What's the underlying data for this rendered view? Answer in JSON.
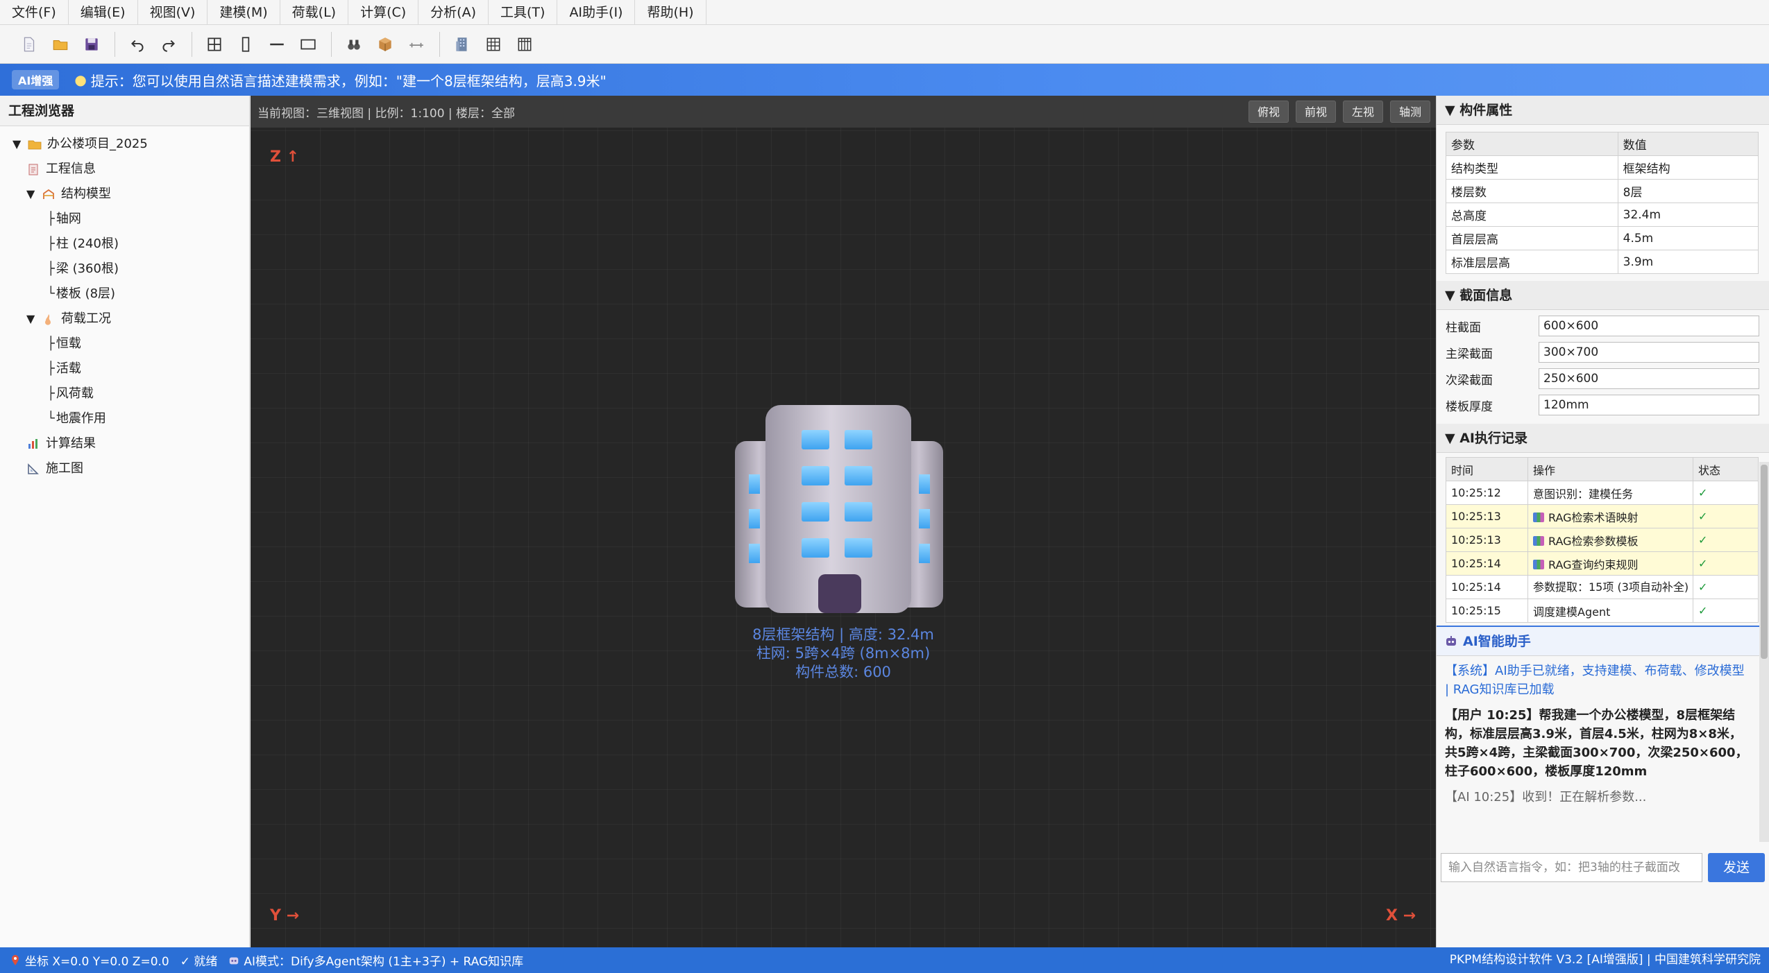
{
  "menu": [
    "文件(F)",
    "编辑(E)",
    "视图(V)",
    "建模(M)",
    "荷载(L)",
    "计算(C)",
    "分析(A)",
    "工具(T)",
    "AI助手(I)",
    "帮助(H)"
  ],
  "toolbar_icons": [
    "new-file-icon",
    "open-folder-icon",
    "save-icon",
    "undo-icon",
    "redo-icon",
    "grid-axis-icon",
    "column-icon",
    "beam-icon",
    "slab-icon",
    "find-icon",
    "3d-box-icon",
    "measure-icon",
    "building-icon",
    "table-icon",
    "columns-table-icon"
  ],
  "ai_banner": {
    "tag": "AI增强",
    "hint": "提示：您可以使用自然语言描述建模需求，例如：\"建一个8层框架结构，层高3.9米\""
  },
  "explorer": {
    "title": "工程浏览器",
    "project": "办公楼项目_2025",
    "project_info": "工程信息",
    "struct_model": "结构模型",
    "axis_grid": "轴网",
    "columns": "柱 (240根)",
    "beams": "梁 (360根)",
    "slabs": "楼板 (8层)",
    "loads": "荷载工况",
    "dead": "恒载",
    "live": "活载",
    "wind": "风荷载",
    "seismic": "地震作用",
    "results": "计算结果",
    "drawings": "施工图"
  },
  "viewport": {
    "info": "当前视图：三维视图 | 比例：1:100 | 楼层：全部",
    "buttons": [
      "俯视",
      "前视",
      "左视",
      "轴测"
    ],
    "axis_z": "Z ↑",
    "axis_y": "Y →",
    "axis_x": "X →",
    "building_line1": "8层框架结构 | 高度: 32.4m",
    "building_line2": "柱网: 5跨×4跨 (8m×8m)",
    "building_line3": "构件总数: 600"
  },
  "props": {
    "title": "▼ 构件属性",
    "col_param": "参数",
    "col_value": "数值",
    "rows": [
      {
        "k": "结构类型",
        "v": "框架结构"
      },
      {
        "k": "楼层数",
        "v": "8层"
      },
      {
        "k": "总高度",
        "v": "32.4m"
      },
      {
        "k": "首层层高",
        "v": "4.5m"
      },
      {
        "k": "标准层层高",
        "v": "3.9m"
      }
    ]
  },
  "section": {
    "title": "▼ 截面信息",
    "rows": [
      {
        "k": "柱截面",
        "v": "600×600"
      },
      {
        "k": "主梁截面",
        "v": "300×700"
      },
      {
        "k": "次梁截面",
        "v": "250×600"
      },
      {
        "k": "楼板厚度",
        "v": "120mm"
      }
    ]
  },
  "ai_log": {
    "title": "▼ AI执行记录",
    "col_time": "时间",
    "col_op": "操作",
    "col_status": "状态",
    "rows": [
      {
        "t": "10:25:12",
        "op": "意图识别：建模任务",
        "s": "✓",
        "rag": false
      },
      {
        "t": "10:25:13",
        "op": "RAG检索术语映射",
        "s": "✓",
        "rag": true
      },
      {
        "t": "10:25:13",
        "op": "RAG检索参数模板",
        "s": "✓",
        "rag": true
      },
      {
        "t": "10:25:14",
        "op": "RAG查询约束规则",
        "s": "✓",
        "rag": true
      },
      {
        "t": "10:25:14",
        "op": "参数提取：15项 (3项自动补全)",
        "s": "✓",
        "rag": false
      },
      {
        "t": "10:25:15",
        "op": "调度建模Agent",
        "s": "✓",
        "rag": false
      }
    ]
  },
  "chat": {
    "title": "AI智能助手",
    "sys": "【系统】AI助手已就绪，支持建模、布荷载、修改模型 | RAG知识库已加载",
    "user": "【用户 10:25】帮我建一个办公楼模型，8层框架结构，标准层层高3.9米，首层4.5米，柱网为8×8米，共5跨×4跨，主梁截面300×700，次梁250×600，柱子600×600，楼板厚度120mm",
    "ai": "【AI 10:25】收到！正在解析参数...",
    "placeholder": "输入自然语言指令，如：把3轴的柱子截面改",
    "send": "发送"
  },
  "status": {
    "coord": "坐标 X=0.0 Y=0.0 Z=0.0",
    "ready": "✓ 就绪",
    "mode": "AI模式：Dify多Agent架构 (1主+3子) + RAG知识库",
    "product": "PKPM结构设计软件 V3.2 [AI增强版] | 中国建筑科学研究院"
  }
}
